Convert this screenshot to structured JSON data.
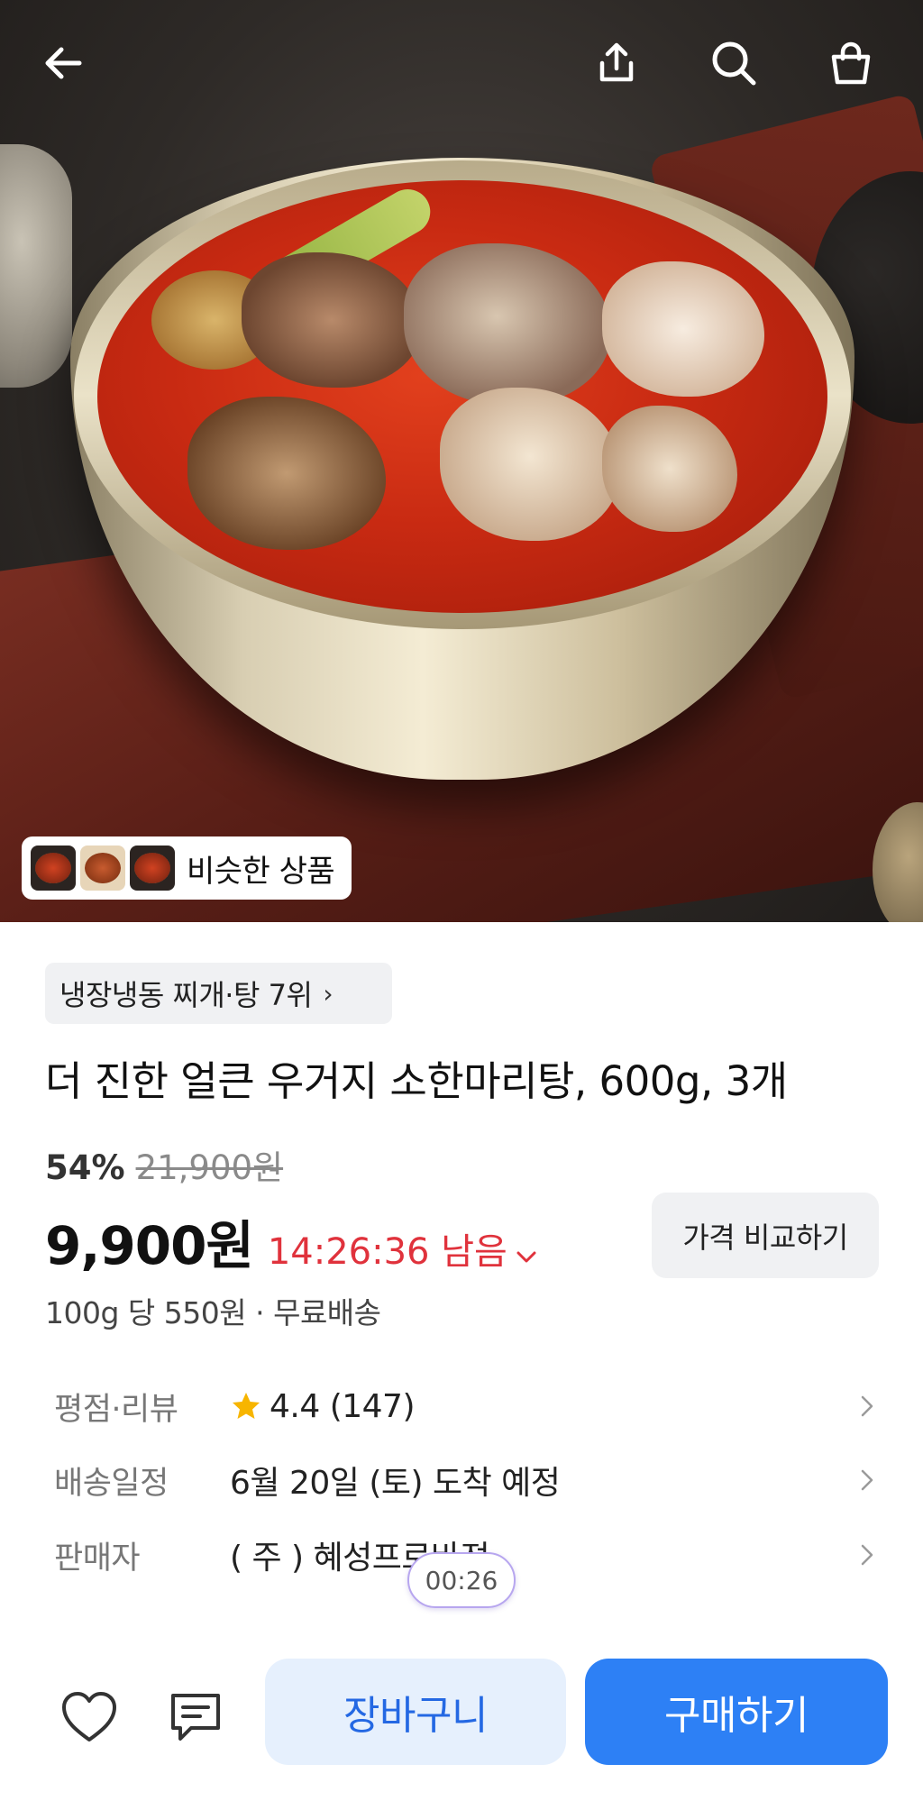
{
  "hero": {
    "similar_products_label": "비슷한 상품"
  },
  "header_icons": [
    "back-arrow-icon",
    "share-icon",
    "search-icon",
    "shopping-bag-icon"
  ],
  "product": {
    "rank_label": "냉장냉동 찌개·탕 7위",
    "title": "더 진한 얼큰 우거지 소한마리탕, 600g, 3개",
    "discount": "54%",
    "original_price": "21,900원",
    "price": "9,900원",
    "timer": "14:26:36 남음",
    "compare_button": "가격 비교하기",
    "unit_price": "100g 당 550원 · 무료배송"
  },
  "info": {
    "rating_label": "평점·리뷰",
    "rating_value": "4.4 (147)",
    "delivery_label": "배송일정",
    "delivery_value": "6월 20일 (토) 도착 예정",
    "seller_label": "판매자",
    "seller_value": "( 주 ) 혜성프로바젼"
  },
  "overlay_timer": "00:26",
  "bottom": {
    "cart_button": "장바구니",
    "buy_button": "구매하기"
  },
  "colors": {
    "accent_blue": "#2d80f5",
    "timer_red": "#e0323c",
    "star_yellow": "#f7b500"
  }
}
